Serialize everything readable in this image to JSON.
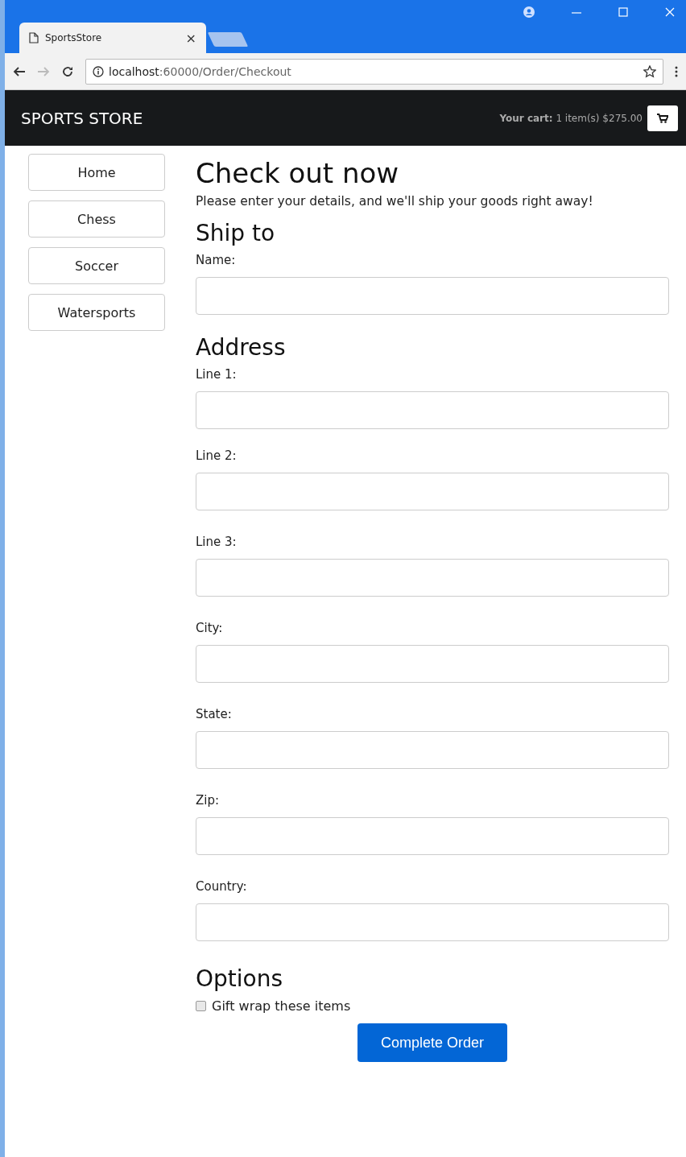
{
  "browser": {
    "tab_title": "SportsStore",
    "tab_close": "×",
    "url_host": "localhost",
    "url_path": ":60000/Order/Checkout"
  },
  "navbar": {
    "brand": "SPORTS STORE",
    "cart_summary": "**Your cart:** 1 item(s) $275.00"
  },
  "categories": [
    {
      "label": "Home"
    },
    {
      "label": "Chess"
    },
    {
      "label": "Soccer"
    },
    {
      "label": "Watersports"
    }
  ],
  "title": "Check out now",
  "intro": "Please enter your details, and we'll ship your goods right away!",
  "sections": [
    {
      "heading": "Ship to",
      "fields": [
        {
          "label": "Name:"
        }
      ]
    },
    {
      "heading": "Address",
      "fields": [
        {
          "label": "Line 1:"
        },
        {
          "label": "Line 2:"
        },
        {
          "label": "Line 3:"
        },
        {
          "label": "City:"
        },
        {
          "label": "State:"
        },
        {
          "label": "Zip:"
        },
        {
          "label": "Country:"
        }
      ]
    },
    {
      "heading": "Options",
      "checkboxes": [
        {
          "label": "Gift wrap these items",
          "checked": false
        }
      ]
    }
  ],
  "submit": "Complete Order"
}
